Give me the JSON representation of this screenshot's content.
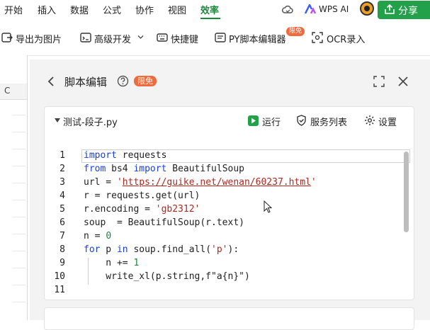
{
  "menu": {
    "items": [
      "开始",
      "插入",
      "数据",
      "公式",
      "协作",
      "视图",
      "效率"
    ],
    "active": "效率",
    "wps_ai": "WPS AI",
    "share": "分享"
  },
  "toolbar": {
    "export_image": "导出为图片",
    "advanced_dev": "高级开发",
    "shortcuts": "快捷键",
    "py_editor": "PY脚本编辑器",
    "py_badge": "限免",
    "ocr": "OCR录入"
  },
  "sheet": {
    "column_label": "C"
  },
  "panel": {
    "title": "脚本编辑",
    "badge": "限免",
    "file_name": "测试-段子.py",
    "run": "运行",
    "service_list": "服务列表",
    "settings": "设置"
  },
  "code": {
    "line_numbers": [
      "1",
      "2",
      "3",
      "4",
      "5",
      "6",
      "7",
      "8",
      "9",
      "10",
      "11"
    ],
    "lines": [
      [
        {
          "t": "import",
          "c": "kw"
        },
        {
          "t": " requests",
          "c": ""
        }
      ],
      [
        {
          "t": "from",
          "c": "kw"
        },
        {
          "t": " bs4 ",
          "c": ""
        },
        {
          "t": "import",
          "c": "kw"
        },
        {
          "t": " BeautifulSoup",
          "c": ""
        }
      ],
      [
        {
          "t": "url = ",
          "c": ""
        },
        {
          "t": "'",
          "c": "str"
        },
        {
          "t": "https://guike.net/wenan/60237.html",
          "c": "str url"
        },
        {
          "t": "'",
          "c": "str"
        }
      ],
      [
        {
          "t": "r = requests.get(url)",
          "c": ""
        }
      ],
      [
        {
          "t": "r.encoding = ",
          "c": ""
        },
        {
          "t": "'gb2312'",
          "c": "str"
        }
      ],
      [
        {
          "t": "soup  = BeautifulSoup(r.text)",
          "c": ""
        }
      ],
      [
        {
          "t": "n = ",
          "c": ""
        },
        {
          "t": "0",
          "c": "num"
        }
      ],
      [
        {
          "t": "for",
          "c": "kw"
        },
        {
          "t": " p ",
          "c": ""
        },
        {
          "t": "in",
          "c": "kw"
        },
        {
          "t": " soup.find_all(",
          "c": ""
        },
        {
          "t": "'p'",
          "c": "str"
        },
        {
          "t": "):",
          "c": ""
        }
      ],
      [
        {
          "t": "    n += ",
          "c": ""
        },
        {
          "t": "1",
          "c": "num"
        }
      ],
      [
        {
          "t": "    write_xl(p.string,f\"a{n}\")",
          "c": ""
        }
      ],
      []
    ]
  },
  "colors": {
    "accent_green": "#22a04a",
    "badge_orange": "#ef6a3c",
    "keyword_blue": "#1a3fe0",
    "string_red": "#b3261e"
  }
}
